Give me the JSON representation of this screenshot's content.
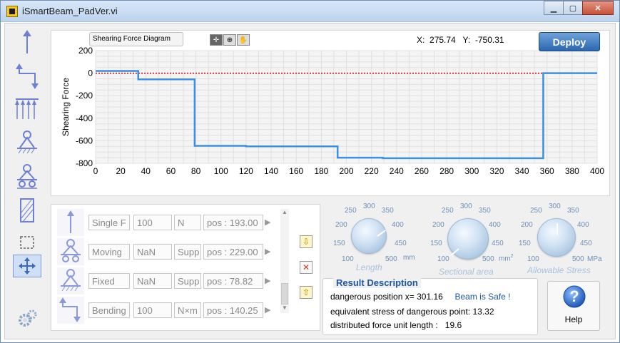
{
  "window": {
    "title": "iSmartBeam_PadVer.vi",
    "controls": {
      "minimize": "▁",
      "maximize": "▢",
      "close": "✕"
    }
  },
  "toolbar_left": {
    "items": [
      "force-arrow-icon",
      "bending-moment-icon",
      "distributed-load-icon",
      "fixed-support-icon",
      "moving-support-icon",
      "section-icon",
      "select-tool-icon",
      "move-tool-icon",
      "settings-gear-icon"
    ]
  },
  "graph": {
    "label": "Shearing Force Diagram",
    "tools": [
      "✛",
      "⊕",
      "✋"
    ],
    "coords_x_label": "X:",
    "coords_x": "275.74",
    "coords_y_label": "Y:",
    "coords_y": "-750.31",
    "deploy_label": "Deploy"
  },
  "chart_data": {
    "type": "line",
    "title": "",
    "xlabel": "",
    "ylabel": "Shearing Force",
    "xlim": [
      0,
      400
    ],
    "ylim": [
      -800,
      200
    ],
    "x_ticks": [
      0,
      20,
      40,
      60,
      80,
      100,
      120,
      140,
      160,
      180,
      200,
      220,
      240,
      260,
      280,
      300,
      320,
      340,
      360,
      380,
      400
    ],
    "y_ticks": [
      200,
      0,
      -200,
      -400,
      -600,
      -800
    ],
    "grid": true,
    "series": [
      {
        "color": "#3d8fe0",
        "points": [
          [
            0,
            20
          ],
          [
            34,
            20
          ],
          [
            34,
            -55
          ],
          [
            79,
            -55
          ],
          [
            79,
            -645
          ],
          [
            120,
            -645
          ],
          [
            120,
            -650
          ],
          [
            193,
            -650
          ],
          [
            193,
            -750
          ],
          [
            229,
            -750
          ],
          [
            229,
            -755
          ],
          [
            357,
            -755
          ],
          [
            357,
            0
          ],
          [
            400,
            0
          ]
        ]
      }
    ],
    "reference_line": {
      "y": 0,
      "color": "#cc0000",
      "style": "dotted"
    }
  },
  "loads": {
    "rows": [
      {
        "icon": "single-force-icon",
        "type": "Single F",
        "value": "100",
        "unit": "N",
        "pos": "pos : 193.00"
      },
      {
        "icon": "moving-support-icon",
        "type": "Moving",
        "value": "NaN",
        "unit": "Supp",
        "pos": "pos : 229.00"
      },
      {
        "icon": "fixed-support-icon",
        "type": "Fixed",
        "value": "NaN",
        "unit": "Supp",
        "pos": "pos : 78.82"
      },
      {
        "icon": "bending-moment-icon",
        "type": "Bending",
        "value": "100",
        "unit": "N×m",
        "pos": "pos : 140.25"
      }
    ],
    "side_buttons": {
      "move_down": "⇩",
      "delete": "✕",
      "move_up": "⇧"
    }
  },
  "dials": [
    {
      "label": "Length",
      "ticks": [
        "250",
        "300",
        "350",
        "400",
        "450",
        "500",
        "100",
        "150",
        "200"
      ],
      "unit": "mm",
      "value": 400
    },
    {
      "label": "Sectional area",
      "ticks": [
        "250",
        "300",
        "350",
        "400",
        "450",
        "500",
        "100",
        "150",
        "200"
      ],
      "unit": "mm",
      "unit_sup": "2",
      "value": 130
    },
    {
      "label": "Allowable Stress",
      "ticks": [
        "250",
        "300",
        "350",
        "400",
        "450",
        "500",
        "100",
        "150",
        "200"
      ],
      "unit": "MPa",
      "value": 300
    }
  ],
  "result": {
    "title": "Result Description",
    "line1_label": "dangerous position x=",
    "line1_value": "301.16",
    "safe_text": "Beam is Safe !",
    "line2_label": "equivalent stress of dangerous point:",
    "line2_value": "13.32",
    "line3_label": "distributed force unit length :",
    "line3_value": "19.6"
  },
  "help": {
    "label": "Help"
  }
}
